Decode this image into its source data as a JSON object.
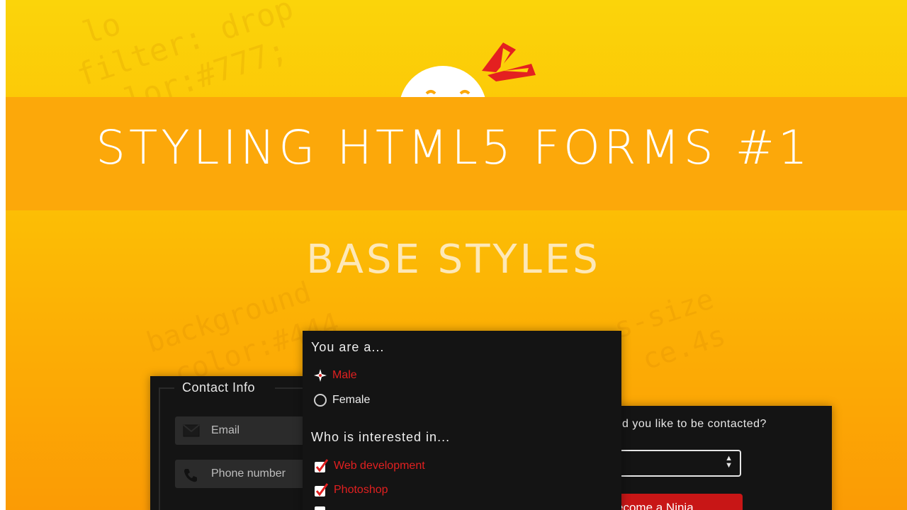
{
  "banner": {
    "title": "STYLING HTML5 FORMS #1",
    "subtitle": "BASE STYLES"
  },
  "background_code": {
    "block_a": "  lo\n filter: drop\n color:#777;",
    "block_b": "background\n color:#444",
    "block_c": "s-size\n ce.4s"
  },
  "colors": {
    "banner": "#fca80a",
    "panel": "#141414",
    "accent_red": "#e12020",
    "button_red": "#c81616"
  },
  "contact_panel": {
    "legend": "Contact Info",
    "fields": [
      {
        "placeholder": "Email",
        "icon": "envelope-icon"
      },
      {
        "placeholder": "Phone number",
        "icon": "phone-icon"
      }
    ]
  },
  "middle_panel": {
    "gender_question": "You are a...",
    "gender_options": [
      {
        "label": "Male",
        "selected": true
      },
      {
        "label": "Female",
        "selected": false
      }
    ],
    "interest_question": "Who is interested in...",
    "interest_options": [
      {
        "label": "Web development",
        "checked": true
      },
      {
        "label": "Photoshop",
        "checked": true
      }
    ]
  },
  "right_panel": {
    "question": "ld you like to be contacted?",
    "select_value": "",
    "button_label": "ecome a Ninja"
  }
}
